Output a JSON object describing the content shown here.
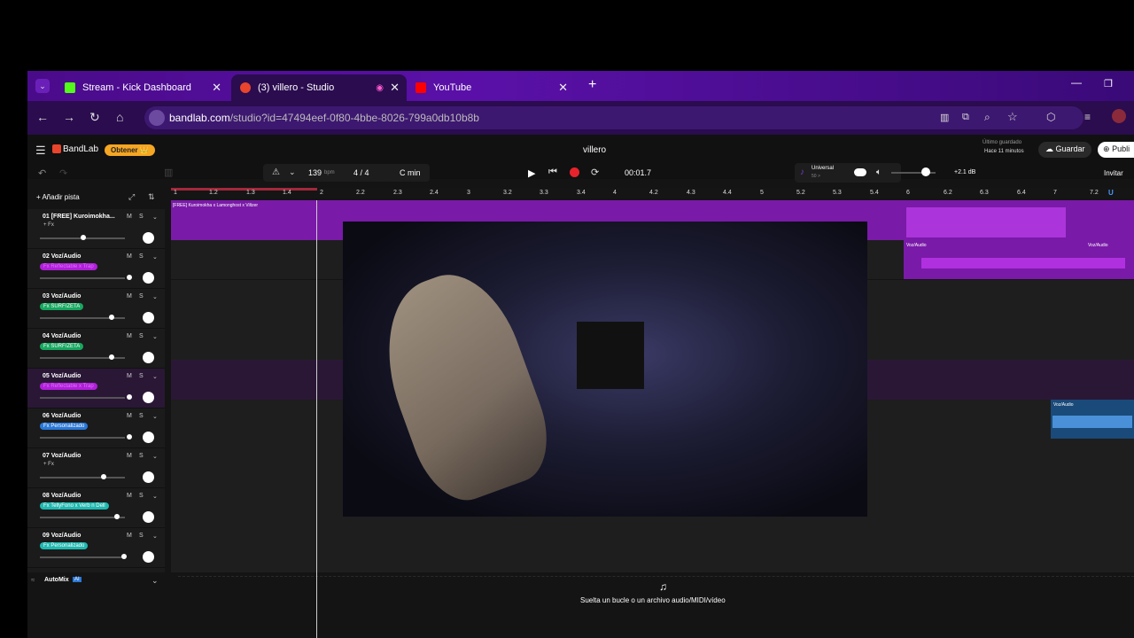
{
  "tabs": [
    {
      "label": "Stream - Kick Dashboard",
      "favicon_color": "#53fc18"
    },
    {
      "label": "(3) villero - Studio",
      "favicon_color": "#e8452c"
    },
    {
      "label": "YouTube",
      "favicon_color": "#ff0000"
    }
  ],
  "url": {
    "domain": "bandlab.com",
    "path": "/studio?id=47494eef-0f80-4bbe-8026-799a0db10b8b"
  },
  "app": {
    "brand": "BandLab",
    "get_button": "Obtener 👑",
    "project_title": "villero",
    "last_saved_label": "Último guardado",
    "last_saved_time": "Hace 11 minutos",
    "save_button": "Guardar",
    "publish_button": "Publi",
    "invite_button": "Invitar",
    "bpm": "139",
    "bpm_unit": "bpm",
    "time_sig": "4 / 4",
    "key": "C min",
    "time": "00:01.7",
    "preset_name": "Universal",
    "preset_sub": "50 >",
    "master_db": "+2.1 dB",
    "add_track": "Añadir pista",
    "automix": "AutoMix",
    "drop_hint": "Suelta un bucle o un archivo audio/MIDI/vídeo"
  },
  "ruler_labels": [
    "1",
    "1.2",
    "1.3",
    "1.4",
    "2",
    "2.2",
    "2.3",
    "2.4",
    "3",
    "3.2",
    "3.3",
    "3.4",
    "4",
    "4.2",
    "4.3",
    "4.4",
    "5",
    "5.2",
    "5.3",
    "5.4",
    "6",
    "6.2",
    "6.3",
    "6.4",
    "7",
    "7.2"
  ],
  "tracks": [
    {
      "name": "01  [FREE] Kuroimokha...",
      "fx": "+ Fx",
      "fx_color": "",
      "vol": 0.5
    },
    {
      "name": "02  Voz/Audio",
      "fx": "Fx Reflectable x Trap",
      "fx_color": "#b020d8",
      "vol": 0.9
    },
    {
      "name": "03  Voz/Audio",
      "fx": "Fx SURF/ZETA",
      "fx_color": "#18a860",
      "vol": 0.8
    },
    {
      "name": "04  Voz/Audio",
      "fx": "Fx SURF/ZETA",
      "fx_color": "#18a860",
      "vol": 0.8
    },
    {
      "name": "05  Voz/Audio",
      "fx": "Fx Reflectable x Trap",
      "fx_color": "#b020d8",
      "vol": 0.9
    },
    {
      "name": "06  Voz/Audio",
      "fx": "Fx Personalizado",
      "fx_color": "#2a78d8",
      "vol": 0.9
    },
    {
      "name": "07  Voz/Audio",
      "fx": "+ Fx",
      "fx_color": "",
      "vol": 0.7
    },
    {
      "name": "08  Voz/Audio",
      "fx": "Fx TellyFono x Verb n Dell",
      "fx_color": "#20b8b0",
      "vol": 0.85
    },
    {
      "name": "09  Voz/Audio",
      "fx": "Fx Personalizado",
      "fx_color": "#20b8b0",
      "vol": 0.85
    }
  ],
  "clips": {
    "track1": "[FREE] Kuroimokha x Lamonghost x Viltzer",
    "voz": "Voz/Audio"
  }
}
